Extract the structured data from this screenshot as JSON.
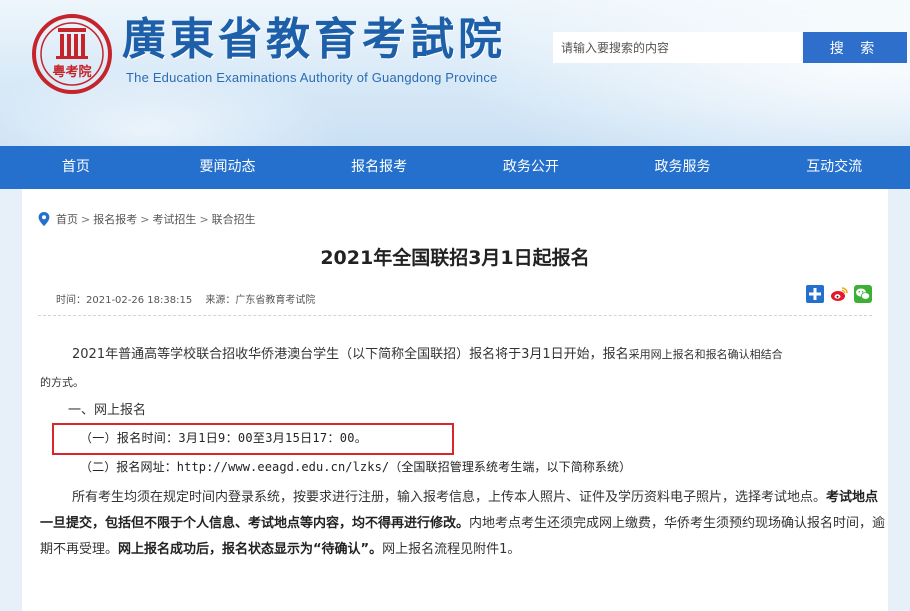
{
  "header": {
    "site_title": "廣東省教育考試院",
    "site_subtitle": "The Education Examinations Authority of Guangdong Province",
    "seal_text": "粤考院",
    "search_placeholder": "请输入要搜索的内容",
    "search_button": "搜 索"
  },
  "nav": {
    "items": [
      "首页",
      "要闻动态",
      "报名报考",
      "政务公开",
      "政务服务",
      "互动交流"
    ]
  },
  "breadcrumb": {
    "items": [
      "首页",
      "报名报考",
      "考试招生",
      "联合招生"
    ],
    "separator": ">"
  },
  "article": {
    "title": "2021年全国联招3月1日起报名",
    "time": "时间：2021-02-26 18:38:15",
    "source": "来源：广东省教育考试院",
    "p1_main": "2021年普通高等学校联合招收华侨港澳台学生（以下简称全国联招）报名将于3月1日开始，报名",
    "p1_small": "采用网上报名和报名确认相结合",
    "p1_end": "的方式。",
    "section1": "一、网上报名",
    "line_time": "（一）报名时间：3月1日9：00至3月15日17：00。",
    "line_url": "（二）报名网址：http://www.eeagd.edu.cn/lzks/（全国联招管理系统考生端，以下简称系统）",
    "para_a": "所有考生均须在规定时间内登录系统，按要求进行注册，输入报考信息，上传本人照片、证件及学历资料电子照片，选择考试地点。",
    "para_b": "考试地点一旦提交，包括但不限于个人信息、考试地点等内容，均不得再进行修改。",
    "para_c": "内地考点考生还须完成网上缴费，华侨考生须预约现场确认报名时间，逾期不再受理。",
    "para_d": "网上报名成功后，报名状态显示为“待确认”。",
    "para_e": "网上报名流程见附件1。"
  },
  "colors": {
    "nav_bg": "#2470cc",
    "title_blue": "#1d5fa8",
    "highlight_red": "#d9262a",
    "search_btn": "#2e6fcc"
  },
  "icons": [
    "location-pin-icon",
    "share-plus-icon",
    "weibo-icon",
    "wechat-icon"
  ]
}
